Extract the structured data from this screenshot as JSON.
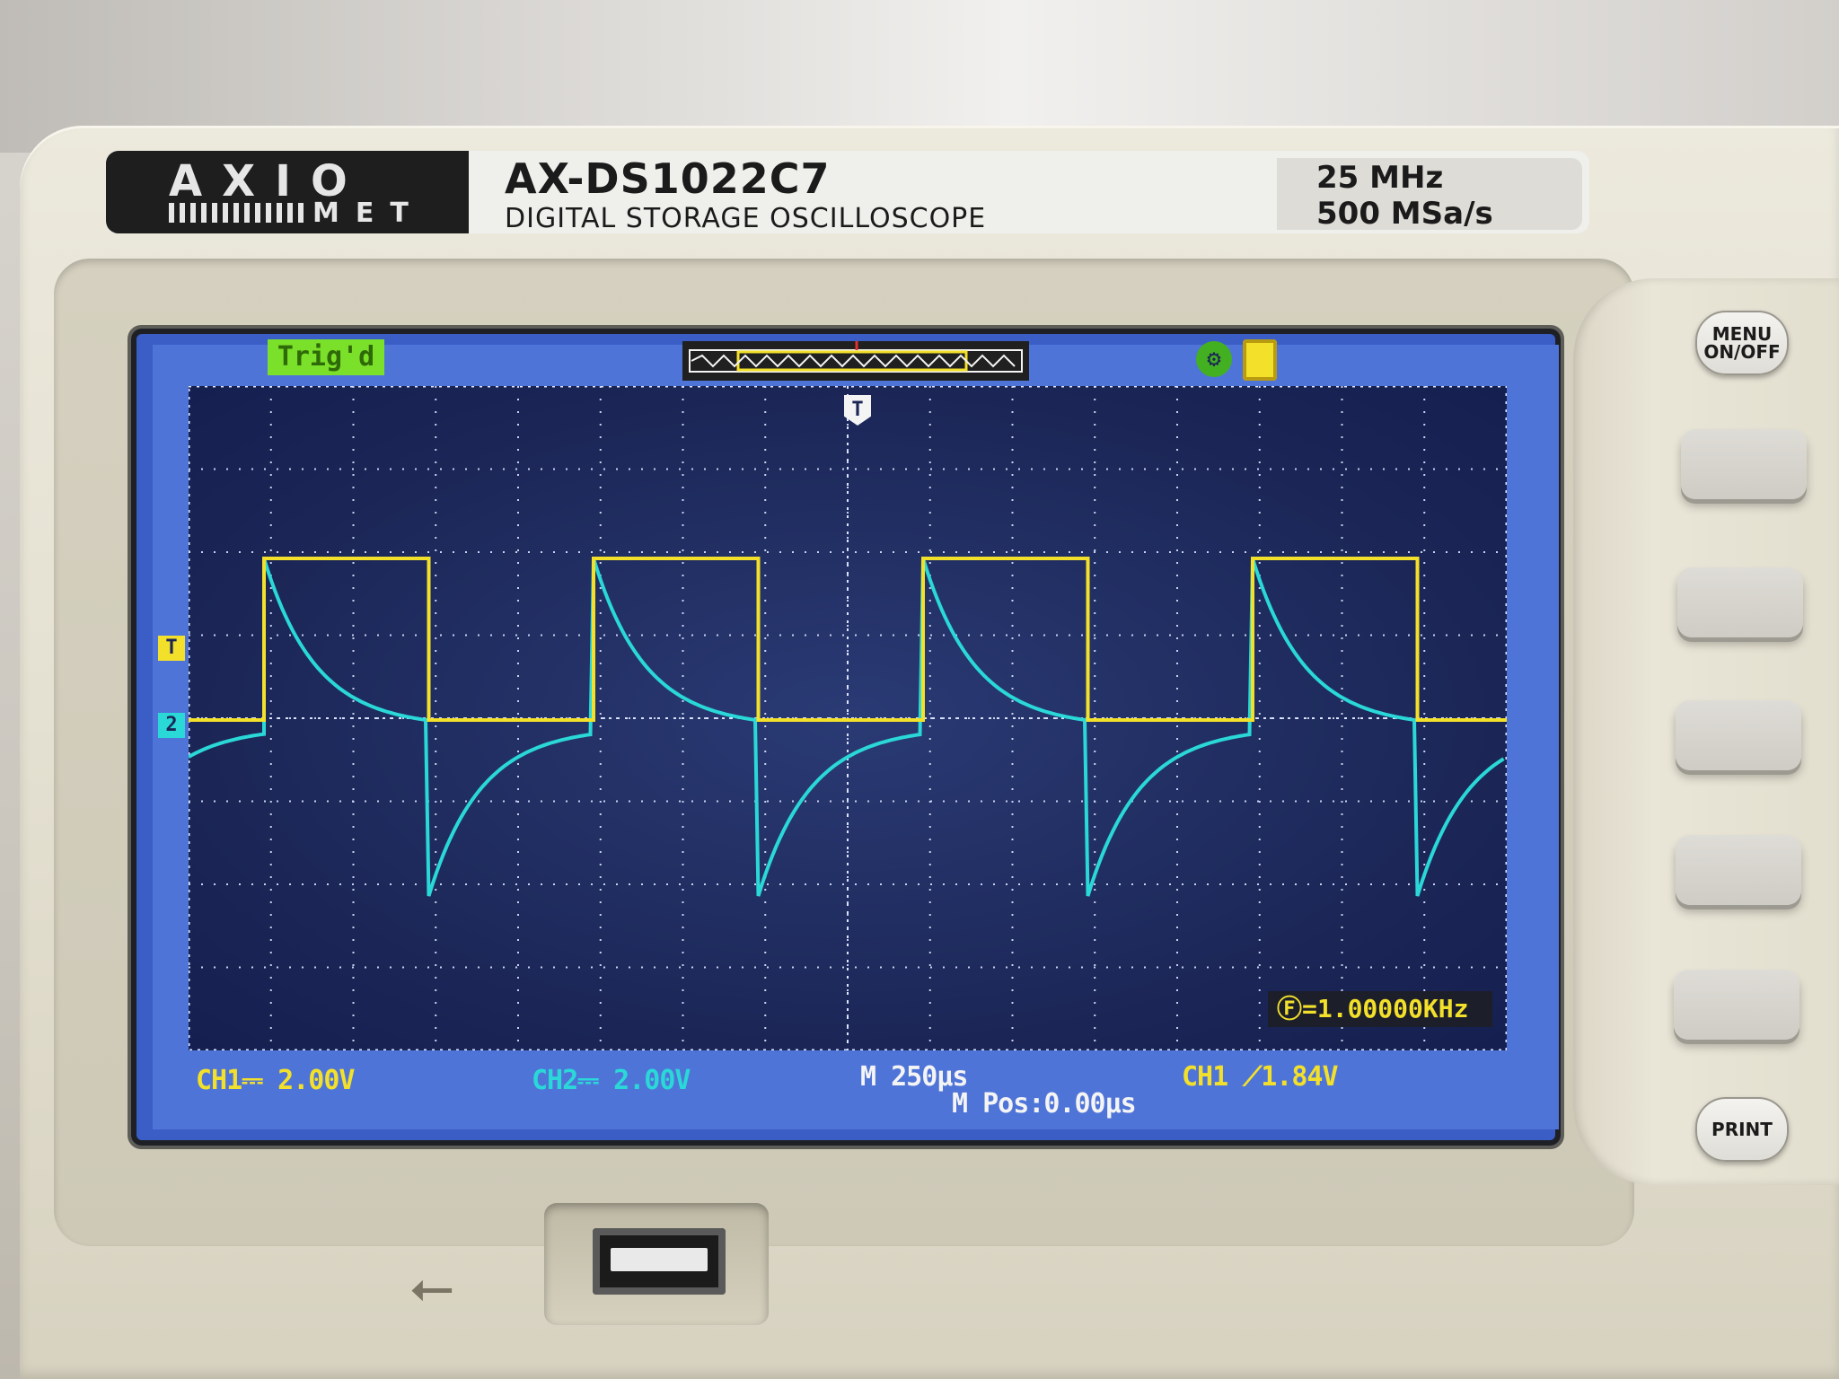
{
  "device": {
    "brand_top": "AXIO",
    "brand_bottom": "MET",
    "model": "AX-DS1022C7",
    "description": "DIGITAL STORAGE OSCILLOSCOPE",
    "bandwidth": "25 MHz",
    "sample_rate": "500 MSa/s"
  },
  "screen": {
    "status": "Trig'd",
    "trigger_marker": "T",
    "ch1_marker": "T",
    "ch2_marker": "2",
    "ch1_scale": "CH1⎓ 2.00V",
    "ch2_scale": "CH2⎓ 2.00V",
    "timebase": "M 250μs",
    "position": "M Pos:0.00μs",
    "trigger_info": "CH1 ⟋1.84V",
    "frequency": "Ⓕ=1.00000KHz"
  },
  "buttons": {
    "menu": "MENU ON/OFF",
    "print": "PRINT"
  },
  "colors": {
    "ch1": "#f2e02a",
    "ch2": "#2ad8d8",
    "screen_bg": "#1b2656",
    "screen_frame": "#4f74d8"
  },
  "icons": {
    "usb": "usb-icon",
    "settings": "gear-icon",
    "printer": "printer-icon"
  },
  "waveform": {
    "ch1_shape": "square",
    "ch2_shape": "exponential decay spikes (RC differentiator)",
    "frequency_khz": 1.0
  }
}
